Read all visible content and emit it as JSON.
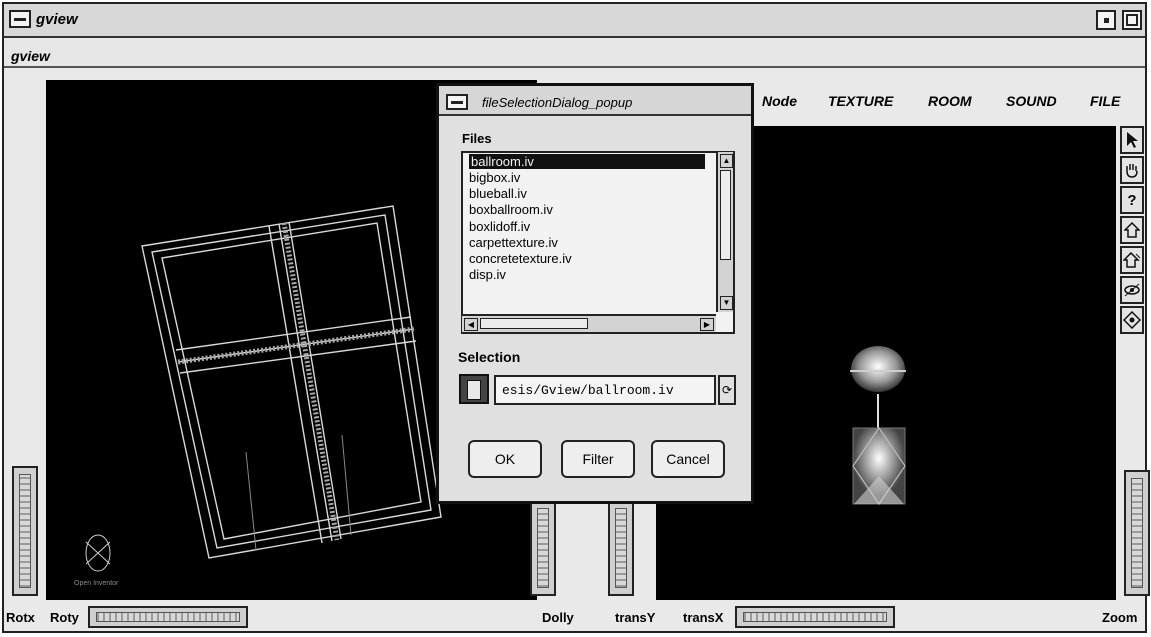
{
  "window": {
    "title": "gview",
    "menubar_title": "gview",
    "menu_icon": "window-menu-icon",
    "right_buttons": [
      "minimize-icon",
      "maximize-icon"
    ]
  },
  "menu": {
    "items": [
      "Node",
      "TEXTURE",
      "ROOM",
      "SOUND",
      "FILE"
    ]
  },
  "toolbar": {
    "icons": [
      "pointer-arrow-icon",
      "hand-icon",
      "help-icon",
      "home-icon",
      "set-home-icon",
      "view-all-icon",
      "seek-icon"
    ],
    "help_glyph": "?"
  },
  "bottom": {
    "rotx_label": "Rotx",
    "roty_label": "Roty",
    "dolly_label": "Dolly",
    "transy_label": "transY",
    "transx_label": "transX",
    "zoom_label": "Zoom"
  },
  "dialog": {
    "title": "fileSelectionDialog_popup",
    "files_label": "Files",
    "files": [
      "ballroom.iv",
      "bigbox.iv",
      "blueball.iv",
      "boxballroom.iv",
      "boxlidoff.iv",
      "carpettexture.iv",
      "concretetexture.iv",
      "disp.iv"
    ],
    "selected_index": 0,
    "selection_label": "Selection",
    "selection_value": "esis/Gview/ballroom.iv",
    "ok_label": "OK",
    "filter_label": "Filter",
    "cancel_label": "Cancel"
  },
  "logo_text": "Open Inventor",
  "colors": {
    "viewport": "#000000",
    "chrome": "#e6e6e6",
    "wireframe": "#d9d9d9"
  }
}
